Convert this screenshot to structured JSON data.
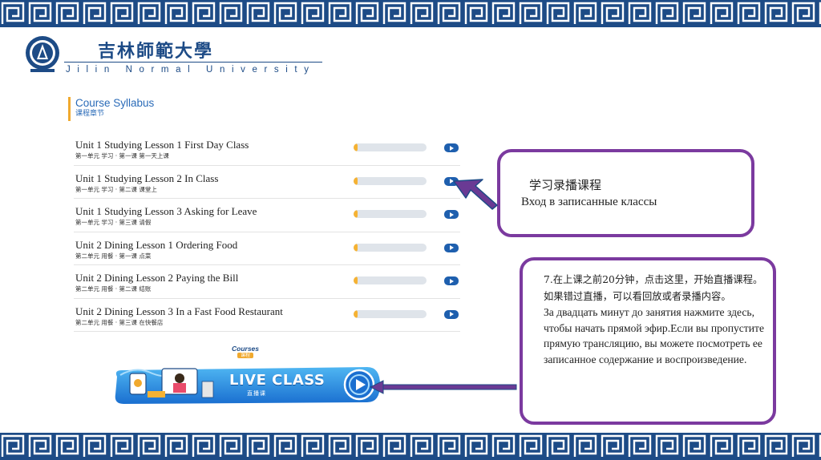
{
  "logo": {
    "name_cn": "吉林師範大學",
    "name_en": "Jilin Normal University"
  },
  "syllabus": {
    "title": "Course Syllabus",
    "subtitle": "课程章节"
  },
  "lessons": [
    {
      "title": "Unit 1 Studying Lesson 1 First Day Class",
      "subtitle": "第一单元 学习 · 第一课 第一天上课",
      "progress": 0.05
    },
    {
      "title": "Unit 1 Studying Lesson 2 In Class",
      "subtitle": "第一单元 学习 · 第二课 课堂上",
      "progress": 0.05
    },
    {
      "title": "Unit 1 Studying Lesson 3 Asking for Leave",
      "subtitle": "第一单元 学习 · 第三课 请假",
      "progress": 0.05
    },
    {
      "title": "Unit 2 Dining Lesson 1 Ordering Food",
      "subtitle": "第二单元 用餐 · 第一课 点菜",
      "progress": 0.05
    },
    {
      "title": "Unit 2 Dining Lesson 2 Paying the Bill",
      "subtitle": "第二单元 用餐 · 第二课 结账",
      "progress": 0.05
    },
    {
      "title": "Unit 2 Dining Lesson 3 In a Fast Food Restaurant",
      "subtitle": "第二单元 用餐 · 第三课 在快餐店",
      "progress": 0.05
    }
  ],
  "courses_tag": {
    "en": "Courses",
    "cn": "课程"
  },
  "live_class": {
    "label": "LIVE CLASS",
    "sub": "直播课"
  },
  "callout_recorded": {
    "cn": "学习录播课程",
    "ru": "Вход в записанные классы"
  },
  "callout_live": {
    "cn": "7.在上课之前20分钟，点击这里，开始直播课程。如果错过直播，可以看回放或者录播内容。",
    "ru": "За двадцать минут до занятия нажмите здесь, чтобы начать прямой эфир.Если вы пропустите прямую трансляцию, вы можете посмотреть ее записанное содержание и воспроизведение."
  },
  "colors": {
    "border_blue": "#1d4b86",
    "accent_orange": "#f0a92e",
    "link_blue": "#2a6bb8",
    "callout_purple": "#7b3a9f",
    "button_blue": "#1e5fae"
  }
}
